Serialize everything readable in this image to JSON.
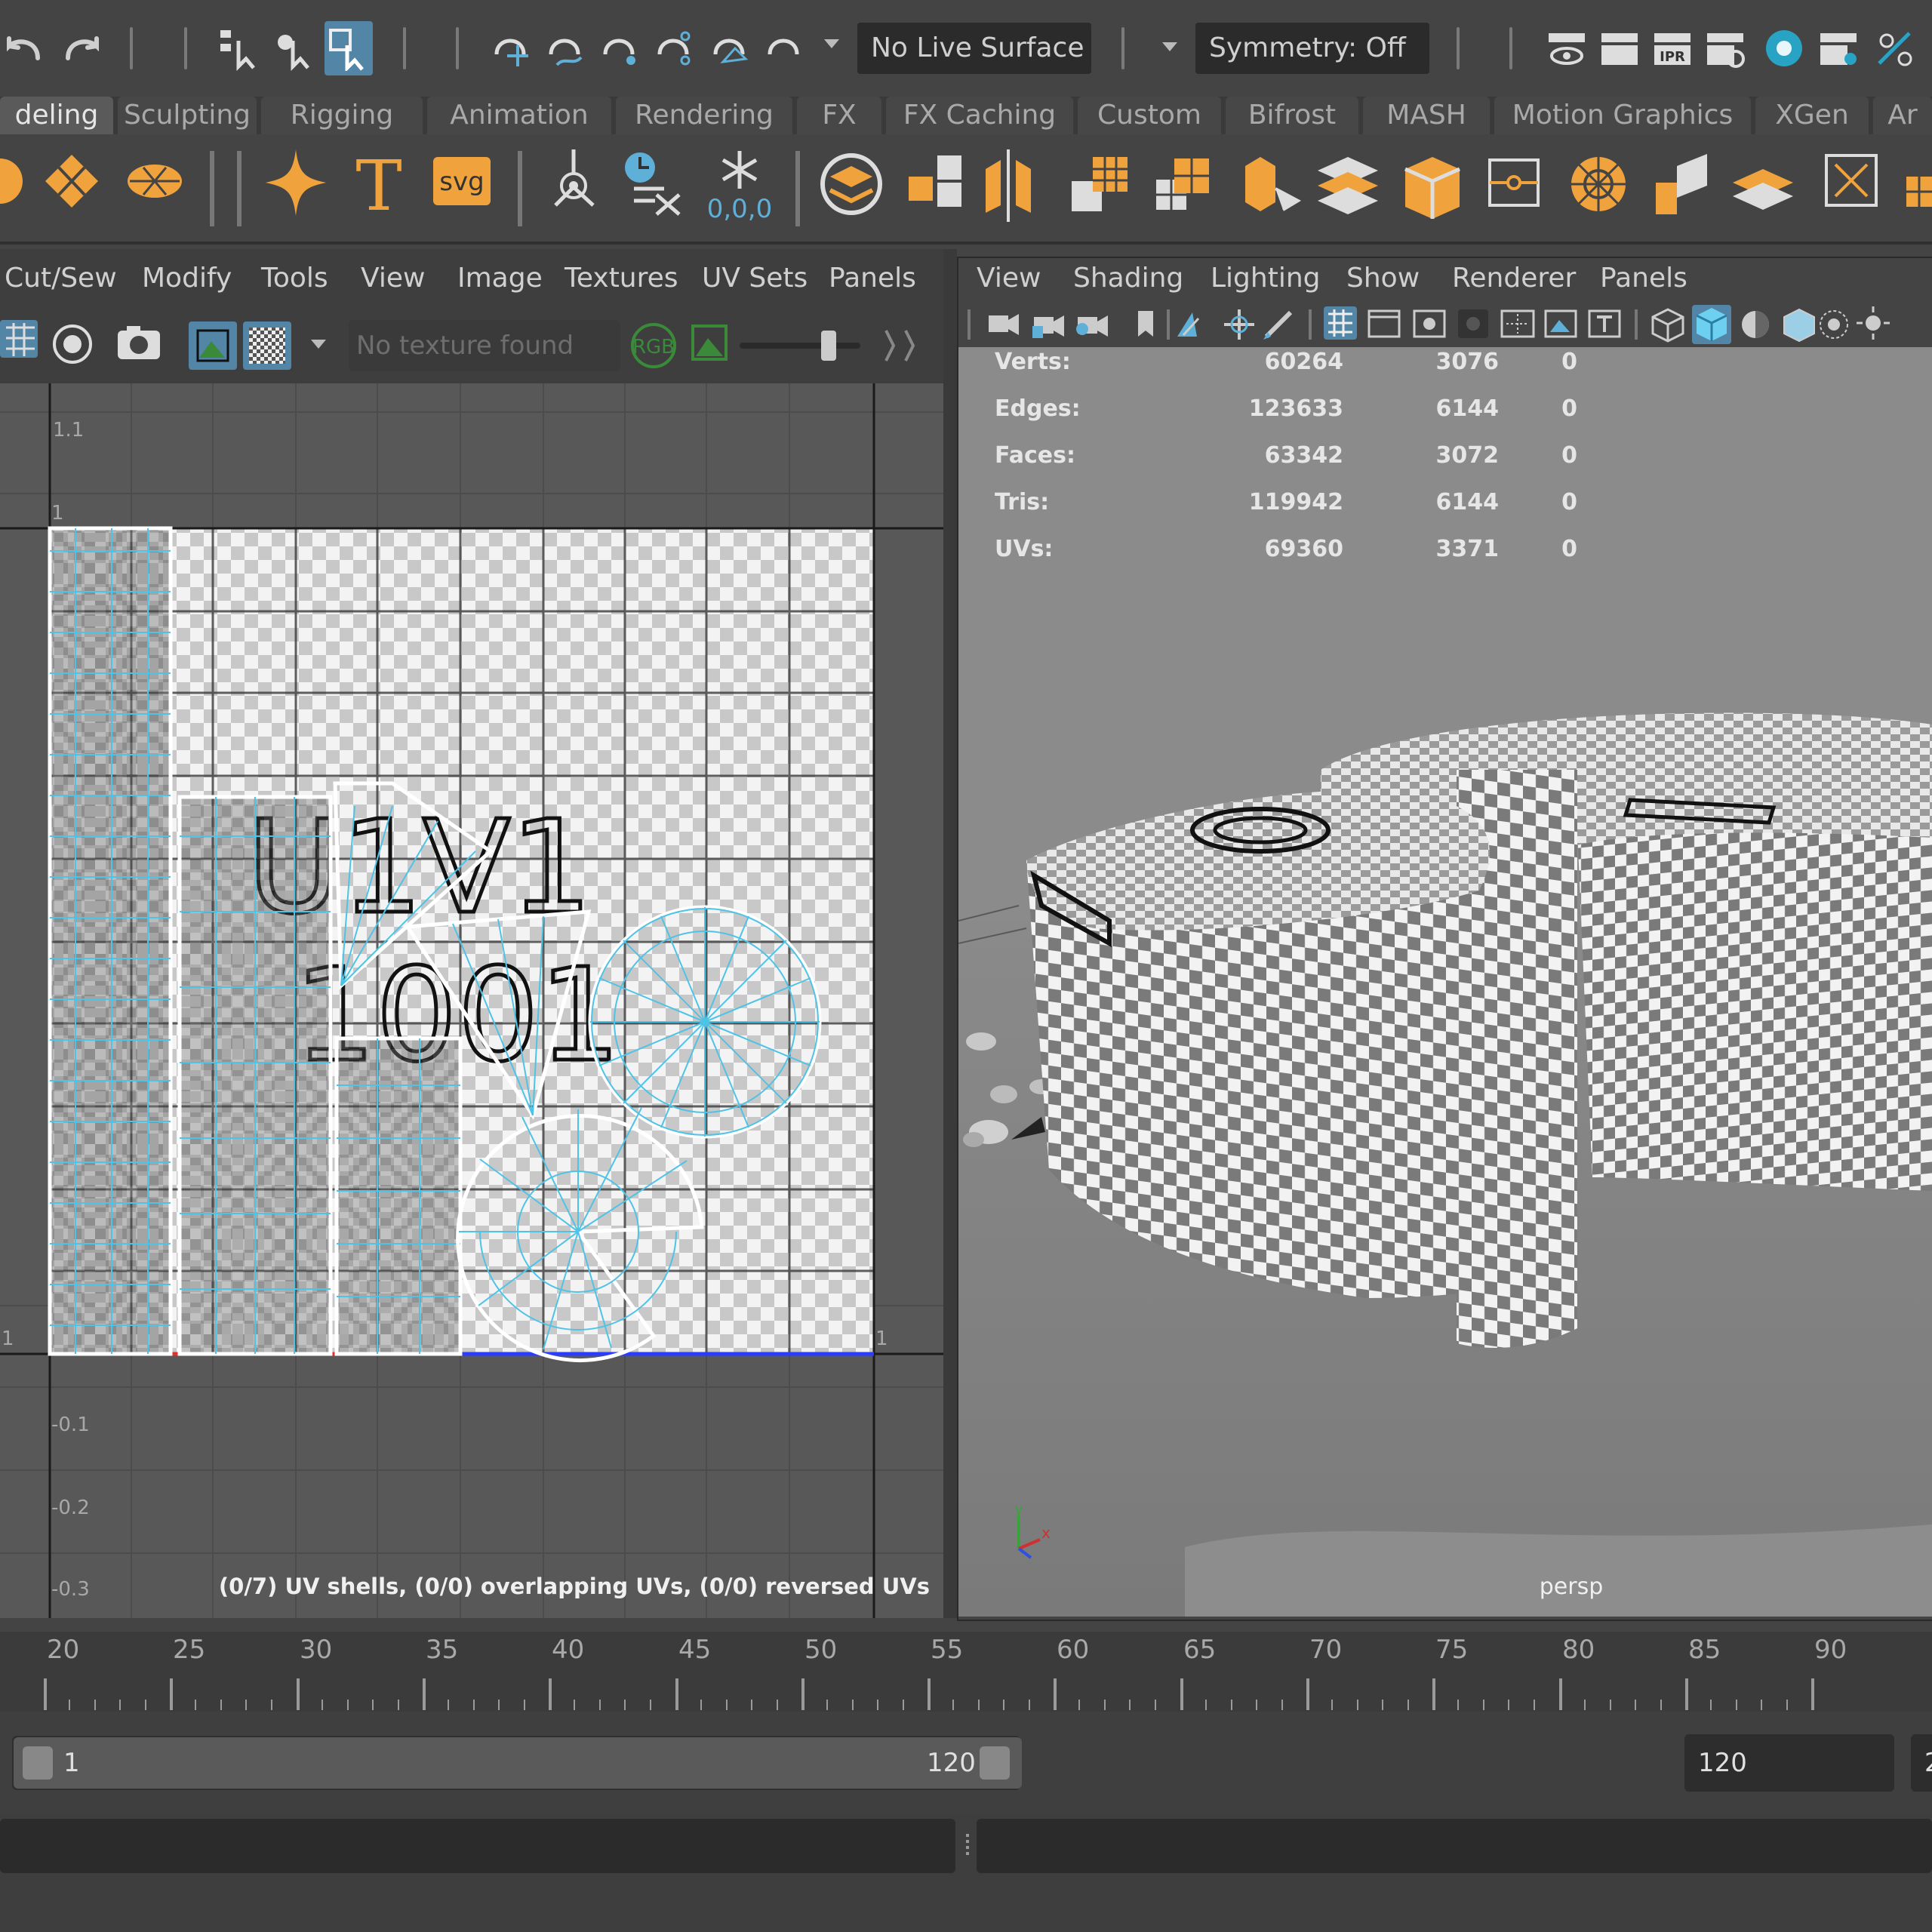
{
  "toolbar": {
    "live_surface": "No Live Surface",
    "symmetry": "Symmetry: Off",
    "ipr_label": "IPR"
  },
  "shelf_tabs": [
    {
      "label": "deling",
      "active": true
    },
    {
      "label": "Sculpting"
    },
    {
      "label": "Rigging"
    },
    {
      "label": "Animation"
    },
    {
      "label": "Rendering"
    },
    {
      "label": "FX"
    },
    {
      "label": "FX Caching"
    },
    {
      "label": "Custom"
    },
    {
      "label": "Bifrost"
    },
    {
      "label": "MASH"
    },
    {
      "label": "Motion Graphics"
    },
    {
      "label": "XGen"
    },
    {
      "label": "Ar"
    }
  ],
  "shelf": {
    "text_tool": "T",
    "svg_tool": "svg",
    "snap_readout": "0,0,0"
  },
  "uv_editor": {
    "menu": [
      "Cut/Sew",
      "Modify",
      "Tools",
      "View",
      "Image",
      "Textures",
      "UV Sets",
      "Panels"
    ],
    "texture_field": "No texture found",
    "rgb_label": "RGB",
    "axis_labels": {
      "v1_1": "1.1",
      "v1": "1",
      "v0": "1",
      "right0": "1",
      "n01": "-0.1",
      "n02": "-0.2",
      "n03": "-0.3"
    },
    "tile_label_line1": "U1V1",
    "tile_label_line2": "1001",
    "status": "(0/7) UV shells, (0/0) overlapping UVs, (0/0) reversed UVs"
  },
  "viewport": {
    "menu": [
      "View",
      "Shading",
      "Lighting",
      "Show",
      "Renderer",
      "Panels"
    ],
    "hud": [
      {
        "label": "Verts:",
        "c1": "60264",
        "c2": "3076",
        "c3": "0"
      },
      {
        "label": "Edges:",
        "c1": "123633",
        "c2": "6144",
        "c3": "0"
      },
      {
        "label": "Faces:",
        "c1": "63342",
        "c2": "3072",
        "c3": "0"
      },
      {
        "label": "Tris:",
        "c1": "119942",
        "c2": "6144",
        "c3": "0"
      },
      {
        "label": "UVs:",
        "c1": "69360",
        "c2": "3371",
        "c3": "0"
      }
    ],
    "camera": "persp",
    "axis_y": "y",
    "axis_x": "x"
  },
  "timeline": {
    "ticks": [
      "20",
      "25",
      "30",
      "35",
      "40",
      "45",
      "50",
      "55",
      "60",
      "65",
      "70",
      "75",
      "80",
      "85",
      "90"
    ]
  },
  "range": {
    "start": "1",
    "end_inner": "120",
    "end_field": "120",
    "trailing": "2"
  },
  "colors": {
    "accent_blue": "#5285a6",
    "shelf_orange": "#f0a23c",
    "uv_wire": "#4fc3e6",
    "u_axis_red": "#e03030",
    "v_axis_blue": "#2a3cff"
  }
}
